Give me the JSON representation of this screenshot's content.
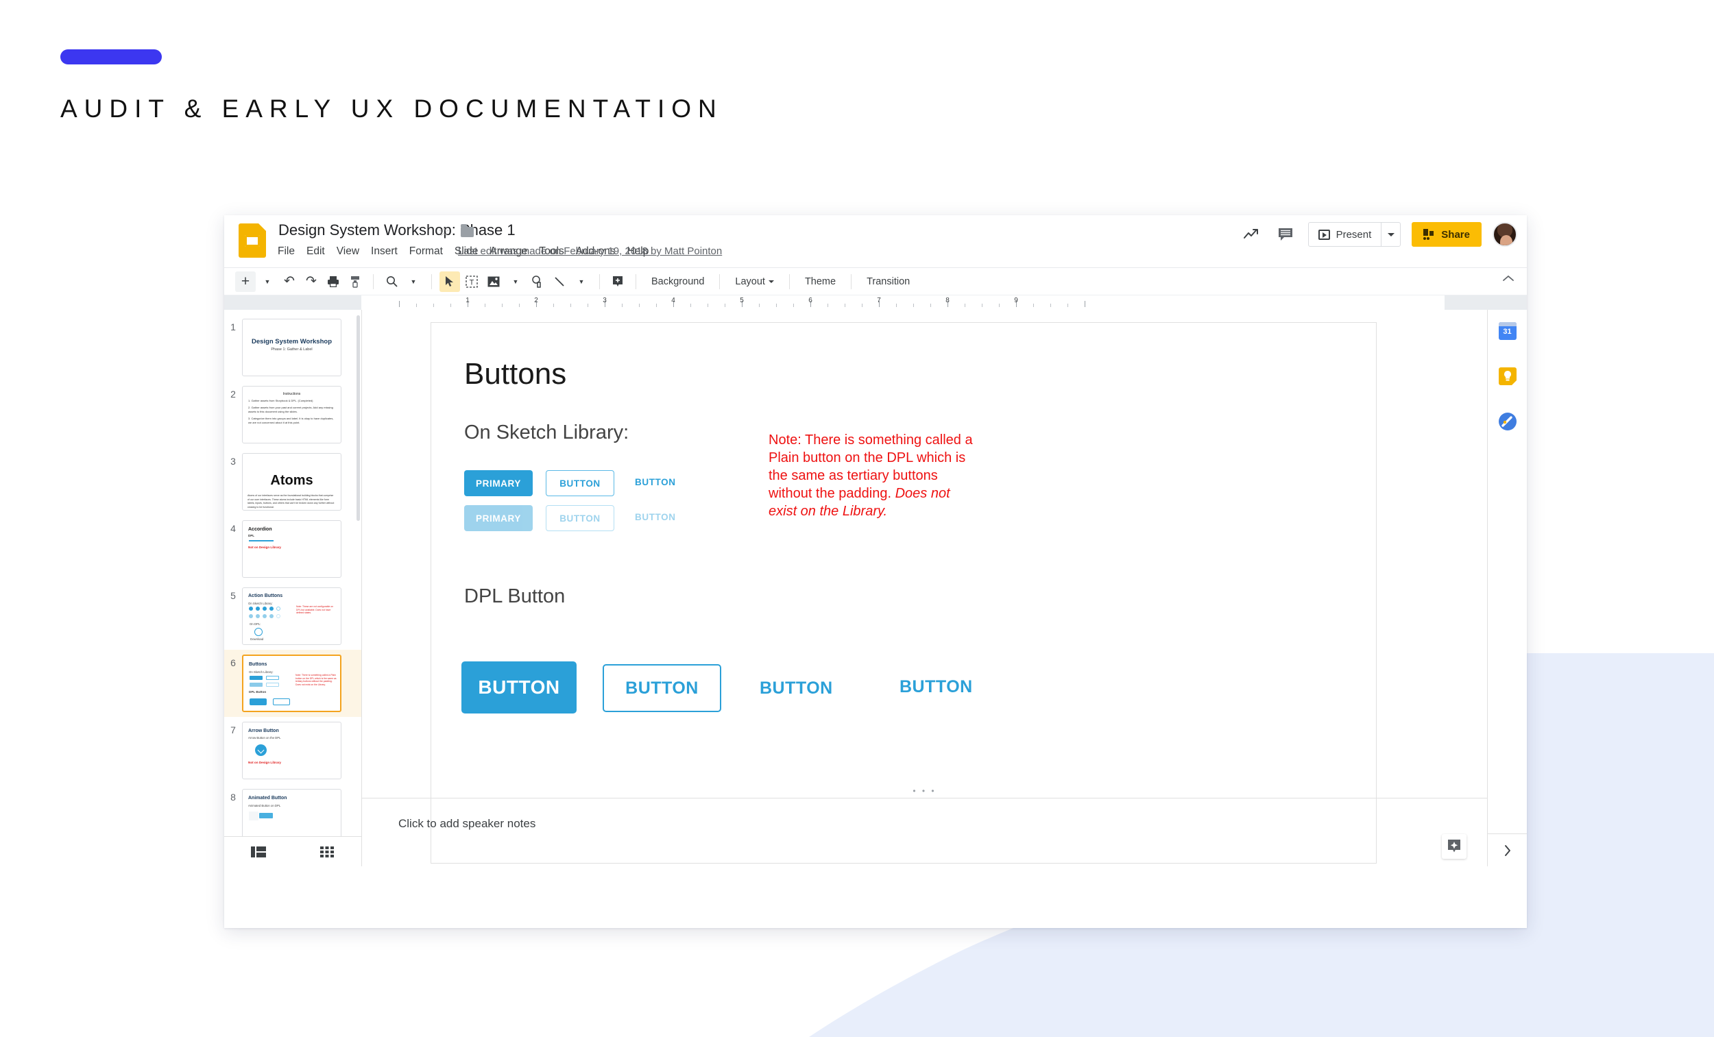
{
  "deck": {
    "accent_color": "#3c37f0",
    "title": "AUDIT & EARLY UX DOCUMENTATION"
  },
  "app": {
    "doc_title": "Design System Workshop: Phase 1",
    "star_icon": "star-icon",
    "folder_icon": "folder-icon",
    "menus": [
      "File",
      "Edit",
      "View",
      "Insert",
      "Format",
      "Slide",
      "Arrange",
      "Tools",
      "Add-ons",
      "Help"
    ],
    "last_edit": "Last edit was made on February 19, 2018 by Matt Pointon",
    "header_actions": {
      "trending_icon": "trending-up-icon",
      "comments_icon": "comment-icon",
      "present_label": "Present",
      "present_caret": "chevron-down-icon",
      "share_label": "Share",
      "avatar": "user-avatar"
    }
  },
  "toolbar": {
    "items": [
      {
        "name": "new-slide-button",
        "glyph": "+"
      },
      {
        "name": "new-slide-caret",
        "glyph": "▾"
      },
      {
        "name": "undo-button",
        "glyph": "↶"
      },
      {
        "name": "redo-button",
        "glyph": "↷"
      },
      {
        "name": "print-button",
        "glyph": "🖶"
      },
      {
        "name": "paint-format-button",
        "glyph": "⌙"
      },
      {
        "name": "zoom-button",
        "glyph": "⌕"
      },
      {
        "name": "zoom-caret",
        "glyph": "▾"
      },
      {
        "name": "select-tool-button",
        "glyph": "➤"
      },
      {
        "name": "text-box-button",
        "glyph": "T"
      },
      {
        "name": "insert-image-button",
        "glyph": "▣"
      },
      {
        "name": "insert-image-caret",
        "glyph": "▾"
      },
      {
        "name": "shape-button",
        "glyph": "◔"
      },
      {
        "name": "line-button",
        "glyph": "＼"
      },
      {
        "name": "line-caret",
        "glyph": "▾"
      },
      {
        "name": "add-comment-button",
        "glyph": "🗩"
      }
    ],
    "background_label": "Background",
    "layout_label": "Layout",
    "theme_label": "Theme",
    "transition_label": "Transition",
    "collapse_icon": "chevron-up-icon"
  },
  "ruler": {
    "numbers": [
      "1",
      "2",
      "3",
      "4",
      "5",
      "6",
      "7",
      "8",
      "9"
    ]
  },
  "filmstrip": {
    "slides": [
      {
        "number": "1",
        "title": "Design System Workshop",
        "subtitle": "Phase 1: Gather & Label",
        "selected": false
      },
      {
        "number": "2",
        "title": "Instructions",
        "lines": [
          "1.  Gather assets from Storybook & DPL. (Completed)",
          "2.  Gather assets from your past and current projects. Add any missing assets to this document using the slides.",
          "3.  Categorize them into groups and label. It is okay to have duplicates, we are not concerned about it at this point."
        ],
        "selected": false
      },
      {
        "number": "3",
        "title": "Atoms",
        "body": "Atoms of our interfaces serve as the foundational building blocks that comprise of our user interfaces. These atoms include basic HTML elements like form labels, inputs, buttons, and others that can't be broken down any further without ceasing to be functional.",
        "selected": false
      },
      {
        "number": "4",
        "title": "Accordion",
        "sub": "DPL",
        "note": "Not on Design Library",
        "selected": false
      },
      {
        "number": "5",
        "title": "Action Buttons",
        "sub": "On Sketch Library:",
        "sub2": "On DPL:",
        "caption": "Download",
        "note": "Note: These are not configurable on DPL but available. Does not have defined states.",
        "selected": false
      },
      {
        "number": "6",
        "title": "Buttons",
        "sub": "On Sketch Library:",
        "sub2": "DPL Button",
        "note": "Note: There is something called a Plain button on the DPL which is the same as tertiary buttons without the padding. Does not exist on the Library.",
        "selected": true
      },
      {
        "number": "7",
        "title": "Arrow Button",
        "sub": "Arrow Button on the DPL",
        "note": "Not on Design Library",
        "selected": false
      },
      {
        "number": "8",
        "title": "Animated Button",
        "sub": "Animated Button on DPL",
        "selected": false
      }
    ],
    "view_buttons": [
      {
        "name": "filmstrip-view-button",
        "icon": "filmstrip-view-icon"
      },
      {
        "name": "grid-view-button",
        "icon": "grid-view-icon"
      }
    ]
  },
  "slide": {
    "heading": "Buttons",
    "section_sketch": "On Sketch Library:",
    "section_dpl": "DPL Button",
    "note": {
      "part1": "Note: There is something called a Plain button on the DPL which is the same as tertiary buttons without the padding. ",
      "italic": "Does not exist on the Library.",
      "color": "#ee1111"
    },
    "sketch_buttons_row1": [
      {
        "label": "PRIMARY",
        "style": "primary"
      },
      {
        "label": "BUTTON",
        "style": "outline"
      },
      {
        "label": "BUTTON",
        "style": "text"
      }
    ],
    "sketch_buttons_row2": [
      {
        "label": "PRIMARY",
        "style": "primary-disabled"
      },
      {
        "label": "BUTTON",
        "style": "outline-disabled"
      },
      {
        "label": "BUTTON",
        "style": "text-disabled"
      }
    ],
    "dpl_buttons": [
      {
        "label": "BUTTON",
        "style": "primary"
      },
      {
        "label": "BUTTON",
        "style": "outline"
      },
      {
        "label": "BUTTON",
        "style": "text"
      },
      {
        "label": "BUTTON",
        "style": "plain"
      }
    ],
    "brand_blue": "#2ba0d8"
  },
  "notes": {
    "placeholder": "Click to add speaker notes",
    "explore_icon": "explore-icon"
  },
  "right_rail": {
    "items": [
      {
        "name": "google-calendar-icon",
        "label": "31"
      },
      {
        "name": "google-keep-icon",
        "label": ""
      },
      {
        "name": "google-tasks-icon",
        "label": ""
      }
    ],
    "expand_icon": "chevron-right-icon"
  }
}
